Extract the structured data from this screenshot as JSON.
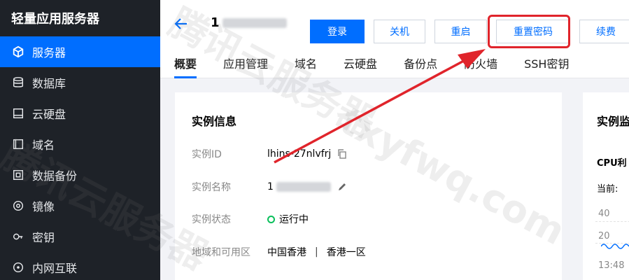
{
  "sidebar": {
    "brand": "轻量应用服务器",
    "items": [
      {
        "label": "服务器",
        "icon": "cube-icon",
        "active": true
      },
      {
        "label": "数据库",
        "icon": "database-icon",
        "active": false
      },
      {
        "label": "云硬盘",
        "icon": "disk-icon",
        "active": false
      },
      {
        "label": "域名",
        "icon": "domain-icon",
        "active": false
      },
      {
        "label": "数据备份",
        "icon": "backup-icon",
        "active": false
      },
      {
        "label": "镜像",
        "icon": "image-icon",
        "active": false
      },
      {
        "label": "密钥",
        "icon": "key-icon",
        "active": false
      },
      {
        "label": "内网互联",
        "icon": "network-icon",
        "active": false
      }
    ]
  },
  "header": {
    "instance_prefix": "1",
    "actions": {
      "login": "登录",
      "shutdown": "关机",
      "restart": "重启",
      "reset_password": "重置密码",
      "renew": "续费"
    },
    "tabs": [
      "概要",
      "应用管理",
      "域名",
      "云硬盘",
      "备份点",
      "防火墙",
      "SSH密钥"
    ]
  },
  "instance_info": {
    "title": "实例信息",
    "id_label": "实例ID",
    "id_value": "lhins-27nlvfrj",
    "name_label": "实例名称",
    "name_value": "1",
    "status_label": "实例状态",
    "status_value": "运行中",
    "region_label": "地域和可用区",
    "region_value": "中国香港",
    "zone_value": "香港一区",
    "separator": "|"
  },
  "monitor": {
    "title": "实例监",
    "cpu_label": "CPU利",
    "current_label": "当前:",
    "tick_40": "40",
    "tick_20": "20",
    "time_label": "13:48"
  },
  "colors": {
    "primary": "#006eff",
    "sidebar_bg": "#1e2228",
    "highlight": "#e0242b",
    "status_green": "#0abf5b"
  },
  "watermark": {
    "lines": [
      "腾讯云服务器",
      "txyfwq.com",
      "腾讯云服务器"
    ]
  }
}
